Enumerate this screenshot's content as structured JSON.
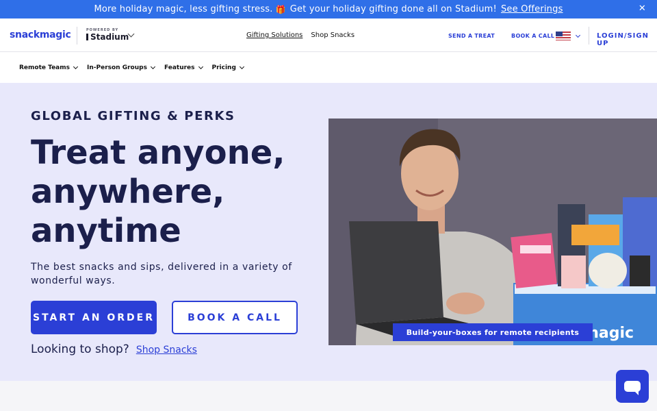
{
  "promo": {
    "text": "More holiday magic, less gifting stress.",
    "gift_icon": "gift-icon",
    "text2": "Get your holiday gifting done all on Stadium!",
    "link": "See Offerings",
    "close_icon": "close-icon"
  },
  "topnav": {
    "logo": "snackmagic",
    "powered_by": "POWERED BY",
    "brand": "Stadium",
    "links": [
      "Gifting Solutions",
      "Shop Snacks"
    ],
    "actions": [
      "SEND A TREAT",
      "BOOK A CALL"
    ],
    "flag_icon": "us-flag-icon",
    "login": "LOGIN/SIGN UP"
  },
  "subnav": {
    "items": [
      "Remote Teams",
      "In-Person Groups",
      "Features",
      "Pricing"
    ]
  },
  "hero": {
    "eyebrow": "GLOBAL GIFTING & PERKS",
    "headline": [
      "Treat anyone,",
      "anywhere,",
      "anytime"
    ],
    "subtitle": "The best snacks and sips, delivered in a variety of wonderful ways.",
    "primary_button": "START AN ORDER",
    "secondary_button": "BOOK A CALL",
    "shop_question": "Looking to shop?",
    "shop_link": "Shop Snacks",
    "photo_caption": "Build-your-boxes for remote recipients",
    "box_text": "magic"
  },
  "colors": {
    "brand_blue": "#2b3fd6",
    "banner_blue": "#2f6fe8",
    "hero_bg": "#e8e8fb",
    "heading": "#1b1f4b"
  }
}
